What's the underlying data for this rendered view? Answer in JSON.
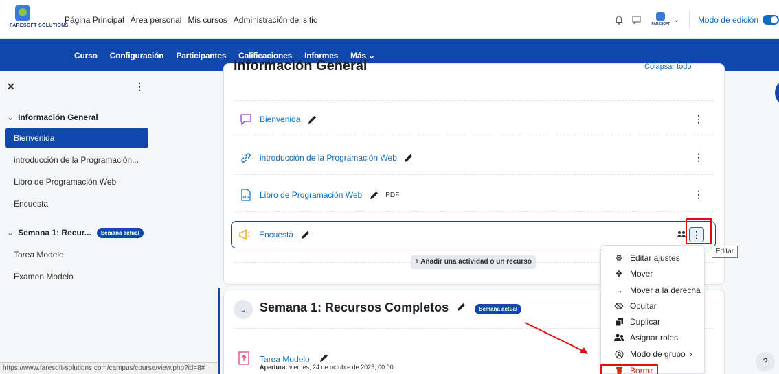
{
  "brand": {
    "logo_text": "FARESOFT SOLUTIONS"
  },
  "topnav": {
    "home": "Página Principal",
    "personal": "Área personal",
    "courses": "Mis cursos",
    "admin": "Administración del sitio"
  },
  "top_right": {
    "edit_mode_label": "Modo de edición",
    "avatar_text": "FARESOFT"
  },
  "secnav": {
    "course": "Curso",
    "settings": "Configuración",
    "participants": "Participantes",
    "grades": "Calificaciones",
    "reports": "Informes",
    "more": "Más"
  },
  "drawer": {
    "sections": [
      {
        "title": "Información General",
        "items": [
          "Bienvenida",
          "introducción de la Programación...",
          "Libro de Programación Web",
          "Encuesta"
        ]
      },
      {
        "title": "Semana 1: Recur...",
        "badge": "Semana actual",
        "items": [
          "Tarea Modelo",
          "Examen Modelo"
        ]
      }
    ],
    "status_url": "https://www.faresoft-solutions.com/campus/course/view.php?id=8#"
  },
  "section1": {
    "title": "Información General",
    "collapse_all": "Colapsar todo",
    "activities": [
      {
        "name": "Bienvenida",
        "icon": "page-icon"
      },
      {
        "name": "introducción de la Programación Web",
        "icon": "link-icon"
      },
      {
        "name": "Libro de Programación Web",
        "icon": "pdf-file-icon",
        "tag": "PDF"
      },
      {
        "name": "Encuesta",
        "icon": "megaphone-icon"
      }
    ],
    "add_button": "+ Añadir una actividad o un recurso"
  },
  "tooltip": "Editar",
  "menu": {
    "items": [
      {
        "label": "Editar ajustes",
        "icon": "gear-icon"
      },
      {
        "label": "Mover",
        "icon": "move-icon"
      },
      {
        "label": "Mover a la derecha",
        "icon": "arrow-right-icon"
      },
      {
        "label": "Ocultar",
        "icon": "eye-slash-icon"
      },
      {
        "label": "Duplicar",
        "icon": "duplicate-icon"
      },
      {
        "label": "Asignar roles",
        "icon": "users-icon"
      },
      {
        "label": "Modo de grupo",
        "icon": "group-mode-icon"
      },
      {
        "label": "Borrar",
        "icon": "trash-icon"
      }
    ]
  },
  "section2": {
    "title": "Semana 1: Recursos Completos",
    "badge": "Semana actual",
    "activity": {
      "name": "Tarea Modelo",
      "open_label": "Apertura:",
      "open_value": "viernes, 24 de octubre de 2025, 00:00"
    }
  },
  "colors": {
    "brand_blue": "#0f47ad",
    "link": "#0f6cbf",
    "danger": "#ca3120",
    "annotation_red": "#e01010"
  }
}
